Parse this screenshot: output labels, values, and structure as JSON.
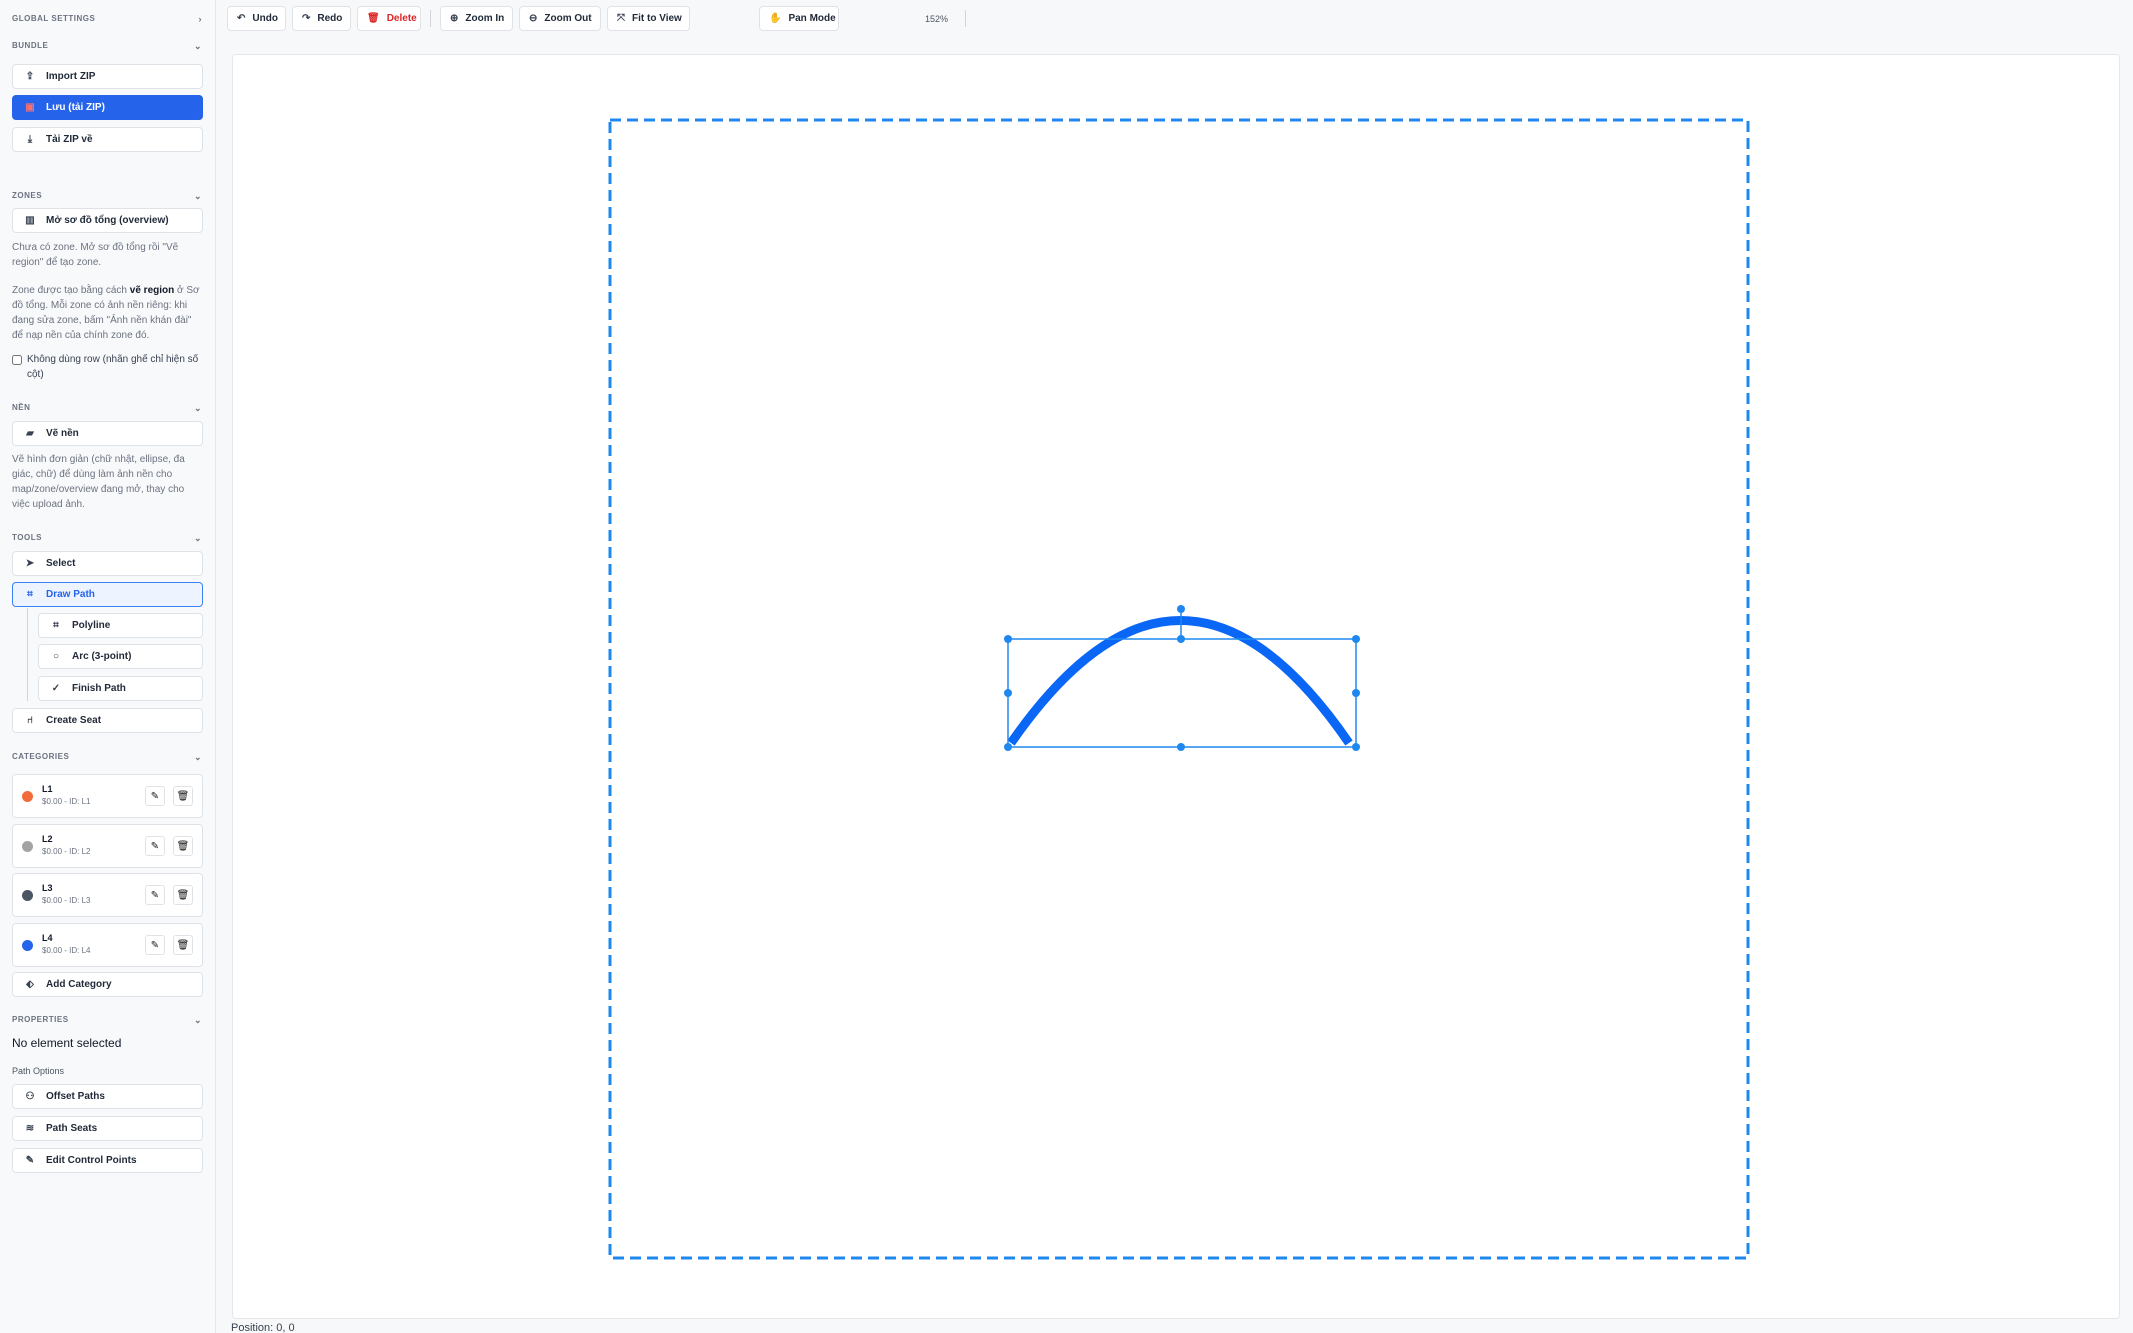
{
  "sidebar": {
    "global_settings": "GLOBAL SETTINGS",
    "bundle": {
      "header": "BUNDLE",
      "import_zip": "Import ZIP",
      "save_zip": "Lưu (tải ZIP)",
      "download_zip": "Tải ZIP về"
    },
    "zones": {
      "header": "ZONES",
      "open_overview": "Mở sơ đồ tổng (overview)",
      "no_zone_note": "Chưa có zone. Mở sơ đồ tổng rồi \"Vẽ region\" để tạo zone.",
      "note_part1": "Zone được tạo bằng cách ",
      "note_bold": "vẽ region",
      "note_part2": " ở Sơ đồ tổng. Mỗi zone có ảnh nền riêng: khi đang sửa zone, bấm \"Ảnh nền khán đài\" để nạp nền của chính zone đó.",
      "no_row_label": "Không dùng row (nhãn ghế chỉ hiện số cột)"
    },
    "background": {
      "header": "NỀN",
      "draw_bg": "Vẽ nền",
      "note": "Vẽ hình đơn giản (chữ nhật, ellipse, đa giác, chữ) để dùng làm ảnh nền cho map/zone/overview đang mở, thay cho việc upload ảnh."
    },
    "tools": {
      "header": "TOOLS",
      "select": "Select",
      "draw_path": "Draw Path",
      "polyline": "Polyline",
      "arc": "Arc (3-point)",
      "finish_path": "Finish Path",
      "create_seat": "Create Seat"
    },
    "categories": {
      "header": "CATEGORIES",
      "items": [
        {
          "name": "L1",
          "meta": "$0.00 - ID: L1",
          "color": "#f26b3a"
        },
        {
          "name": "L2",
          "meta": "$0.00 - ID: L2",
          "color": "#a3a3a3"
        },
        {
          "name": "L3",
          "meta": "$0.00 - ID: L3",
          "color": "#4b5563"
        },
        {
          "name": "L4",
          "meta": "$0.00 - ID: L4",
          "color": "#2563eb"
        }
      ],
      "add_category": "Add Category"
    },
    "properties": {
      "header": "PROPERTIES",
      "no_element": "No element selected",
      "path_options": "Path Options",
      "offset_paths": "Offset Paths",
      "path_seats": "Path Seats",
      "edit_control_points": "Edit Control Points"
    },
    "chevron_icon": "chevron-down-icon"
  },
  "toolbar": {
    "undo": "Undo",
    "redo": "Redo",
    "delete": "Delete",
    "zoom_in": "Zoom In",
    "zoom_out": "Zoom Out",
    "fit_to_view": "Fit to View",
    "zoom_level": "152%",
    "pan_mode": "Pan Mode"
  },
  "status": {
    "position": "Position: 0, 0"
  },
  "colors": {
    "accent": "#2563eb",
    "boundary": "#1e88f0",
    "path": "#0a66f5",
    "danger": "#dc2626"
  }
}
